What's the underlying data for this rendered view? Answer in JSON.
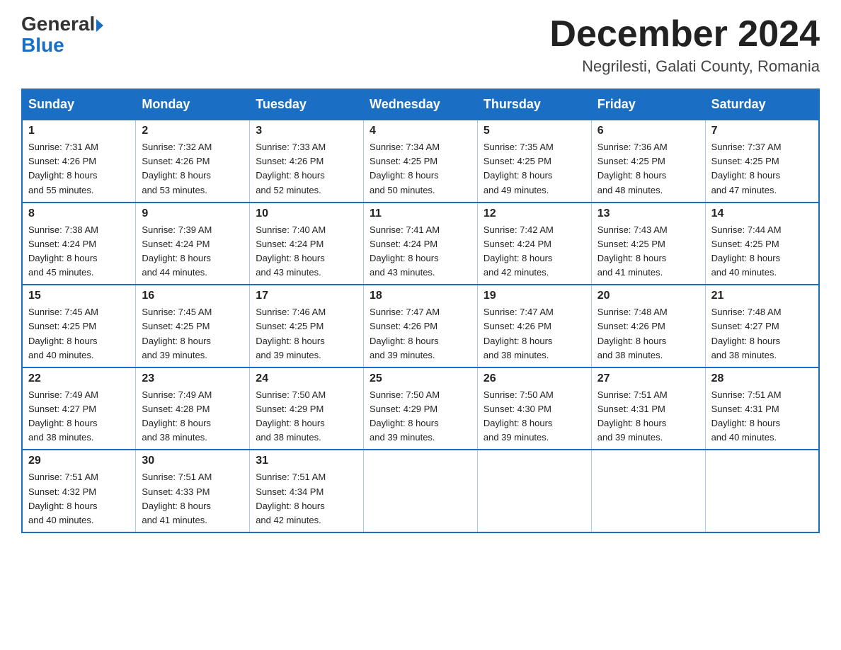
{
  "logo": {
    "text1": "General",
    "text2": "Blue"
  },
  "header": {
    "title": "December 2024",
    "location": "Negrilesti, Galati County, Romania"
  },
  "days_of_week": [
    "Sunday",
    "Monday",
    "Tuesday",
    "Wednesday",
    "Thursday",
    "Friday",
    "Saturday"
  ],
  "weeks": [
    [
      {
        "day": "1",
        "sunrise": "7:31 AM",
        "sunset": "4:26 PM",
        "daylight": "8 hours and 55 minutes."
      },
      {
        "day": "2",
        "sunrise": "7:32 AM",
        "sunset": "4:26 PM",
        "daylight": "8 hours and 53 minutes."
      },
      {
        "day": "3",
        "sunrise": "7:33 AM",
        "sunset": "4:26 PM",
        "daylight": "8 hours and 52 minutes."
      },
      {
        "day": "4",
        "sunrise": "7:34 AM",
        "sunset": "4:25 PM",
        "daylight": "8 hours and 50 minutes."
      },
      {
        "day": "5",
        "sunrise": "7:35 AM",
        "sunset": "4:25 PM",
        "daylight": "8 hours and 49 minutes."
      },
      {
        "day": "6",
        "sunrise": "7:36 AM",
        "sunset": "4:25 PM",
        "daylight": "8 hours and 48 minutes."
      },
      {
        "day": "7",
        "sunrise": "7:37 AM",
        "sunset": "4:25 PM",
        "daylight": "8 hours and 47 minutes."
      }
    ],
    [
      {
        "day": "8",
        "sunrise": "7:38 AM",
        "sunset": "4:24 PM",
        "daylight": "8 hours and 45 minutes."
      },
      {
        "day": "9",
        "sunrise": "7:39 AM",
        "sunset": "4:24 PM",
        "daylight": "8 hours and 44 minutes."
      },
      {
        "day": "10",
        "sunrise": "7:40 AM",
        "sunset": "4:24 PM",
        "daylight": "8 hours and 43 minutes."
      },
      {
        "day": "11",
        "sunrise": "7:41 AM",
        "sunset": "4:24 PM",
        "daylight": "8 hours and 43 minutes."
      },
      {
        "day": "12",
        "sunrise": "7:42 AM",
        "sunset": "4:24 PM",
        "daylight": "8 hours and 42 minutes."
      },
      {
        "day": "13",
        "sunrise": "7:43 AM",
        "sunset": "4:25 PM",
        "daylight": "8 hours and 41 minutes."
      },
      {
        "day": "14",
        "sunrise": "7:44 AM",
        "sunset": "4:25 PM",
        "daylight": "8 hours and 40 minutes."
      }
    ],
    [
      {
        "day": "15",
        "sunrise": "7:45 AM",
        "sunset": "4:25 PM",
        "daylight": "8 hours and 40 minutes."
      },
      {
        "day": "16",
        "sunrise": "7:45 AM",
        "sunset": "4:25 PM",
        "daylight": "8 hours and 39 minutes."
      },
      {
        "day": "17",
        "sunrise": "7:46 AM",
        "sunset": "4:25 PM",
        "daylight": "8 hours and 39 minutes."
      },
      {
        "day": "18",
        "sunrise": "7:47 AM",
        "sunset": "4:26 PM",
        "daylight": "8 hours and 39 minutes."
      },
      {
        "day": "19",
        "sunrise": "7:47 AM",
        "sunset": "4:26 PM",
        "daylight": "8 hours and 38 minutes."
      },
      {
        "day": "20",
        "sunrise": "7:48 AM",
        "sunset": "4:26 PM",
        "daylight": "8 hours and 38 minutes."
      },
      {
        "day": "21",
        "sunrise": "7:48 AM",
        "sunset": "4:27 PM",
        "daylight": "8 hours and 38 minutes."
      }
    ],
    [
      {
        "day": "22",
        "sunrise": "7:49 AM",
        "sunset": "4:27 PM",
        "daylight": "8 hours and 38 minutes."
      },
      {
        "day": "23",
        "sunrise": "7:49 AM",
        "sunset": "4:28 PM",
        "daylight": "8 hours and 38 minutes."
      },
      {
        "day": "24",
        "sunrise": "7:50 AM",
        "sunset": "4:29 PM",
        "daylight": "8 hours and 38 minutes."
      },
      {
        "day": "25",
        "sunrise": "7:50 AM",
        "sunset": "4:29 PM",
        "daylight": "8 hours and 39 minutes."
      },
      {
        "day": "26",
        "sunrise": "7:50 AM",
        "sunset": "4:30 PM",
        "daylight": "8 hours and 39 minutes."
      },
      {
        "day": "27",
        "sunrise": "7:51 AM",
        "sunset": "4:31 PM",
        "daylight": "8 hours and 39 minutes."
      },
      {
        "day": "28",
        "sunrise": "7:51 AM",
        "sunset": "4:31 PM",
        "daylight": "8 hours and 40 minutes."
      }
    ],
    [
      {
        "day": "29",
        "sunrise": "7:51 AM",
        "sunset": "4:32 PM",
        "daylight": "8 hours and 40 minutes."
      },
      {
        "day": "30",
        "sunrise": "7:51 AM",
        "sunset": "4:33 PM",
        "daylight": "8 hours and 41 minutes."
      },
      {
        "day": "31",
        "sunrise": "7:51 AM",
        "sunset": "4:34 PM",
        "daylight": "8 hours and 42 minutes."
      },
      null,
      null,
      null,
      null
    ]
  ],
  "labels": {
    "sunrise": "Sunrise:",
    "sunset": "Sunset:",
    "daylight": "Daylight:"
  }
}
